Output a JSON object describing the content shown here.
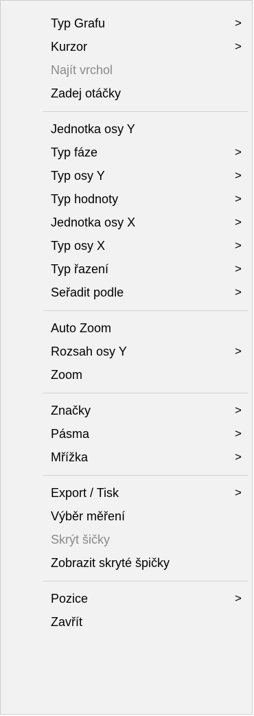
{
  "menu": {
    "groups": [
      {
        "items": [
          {
            "label": "Typ Grafu",
            "submenu": true,
            "disabled": false
          },
          {
            "label": "Kurzor",
            "submenu": true,
            "disabled": false
          },
          {
            "label": "Najít vrchol",
            "submenu": false,
            "disabled": true
          },
          {
            "label": "Zadej otáčky",
            "submenu": false,
            "disabled": false
          }
        ]
      },
      {
        "items": [
          {
            "label": "Jednotka osy Y",
            "submenu": false,
            "disabled": false
          },
          {
            "label": "Typ fáze",
            "submenu": true,
            "disabled": false
          },
          {
            "label": "Typ osy Y",
            "submenu": true,
            "disabled": false
          },
          {
            "label": "Typ hodnoty",
            "submenu": true,
            "disabled": false
          },
          {
            "label": "Jednotka osy X",
            "submenu": true,
            "disabled": false
          },
          {
            "label": "Typ osy X",
            "submenu": true,
            "disabled": false
          },
          {
            "label": "Typ řazení",
            "submenu": true,
            "disabled": false
          },
          {
            "label": "Seřadit podle",
            "submenu": true,
            "disabled": false
          }
        ]
      },
      {
        "items": [
          {
            "label": "Auto Zoom",
            "submenu": false,
            "disabled": false
          },
          {
            "label": "Rozsah osy Y",
            "submenu": true,
            "disabled": false
          },
          {
            "label": "Zoom",
            "submenu": false,
            "disabled": false
          }
        ]
      },
      {
        "items": [
          {
            "label": "Značky",
            "submenu": true,
            "disabled": false
          },
          {
            "label": "Pásma",
            "submenu": true,
            "disabled": false
          },
          {
            "label": "Mřížka",
            "submenu": true,
            "disabled": false
          }
        ]
      },
      {
        "items": [
          {
            "label": "Export / Tisk",
            "submenu": true,
            "disabled": false
          },
          {
            "label": "Výběr měření",
            "submenu": false,
            "disabled": false
          },
          {
            "label": "Skrýt šičky",
            "submenu": false,
            "disabled": true
          },
          {
            "label": "Zobrazit skryté špičky",
            "submenu": false,
            "disabled": false
          }
        ]
      },
      {
        "items": [
          {
            "label": "Pozice",
            "submenu": true,
            "disabled": false
          },
          {
            "label": "Zavřít",
            "submenu": false,
            "disabled": false
          }
        ]
      }
    ],
    "submenu_arrow": ">",
    "colors": {
      "background": "#f2f2f2",
      "text": "#000000",
      "disabled_text": "#8a8a8a",
      "separator": "#d2d2d2"
    }
  }
}
